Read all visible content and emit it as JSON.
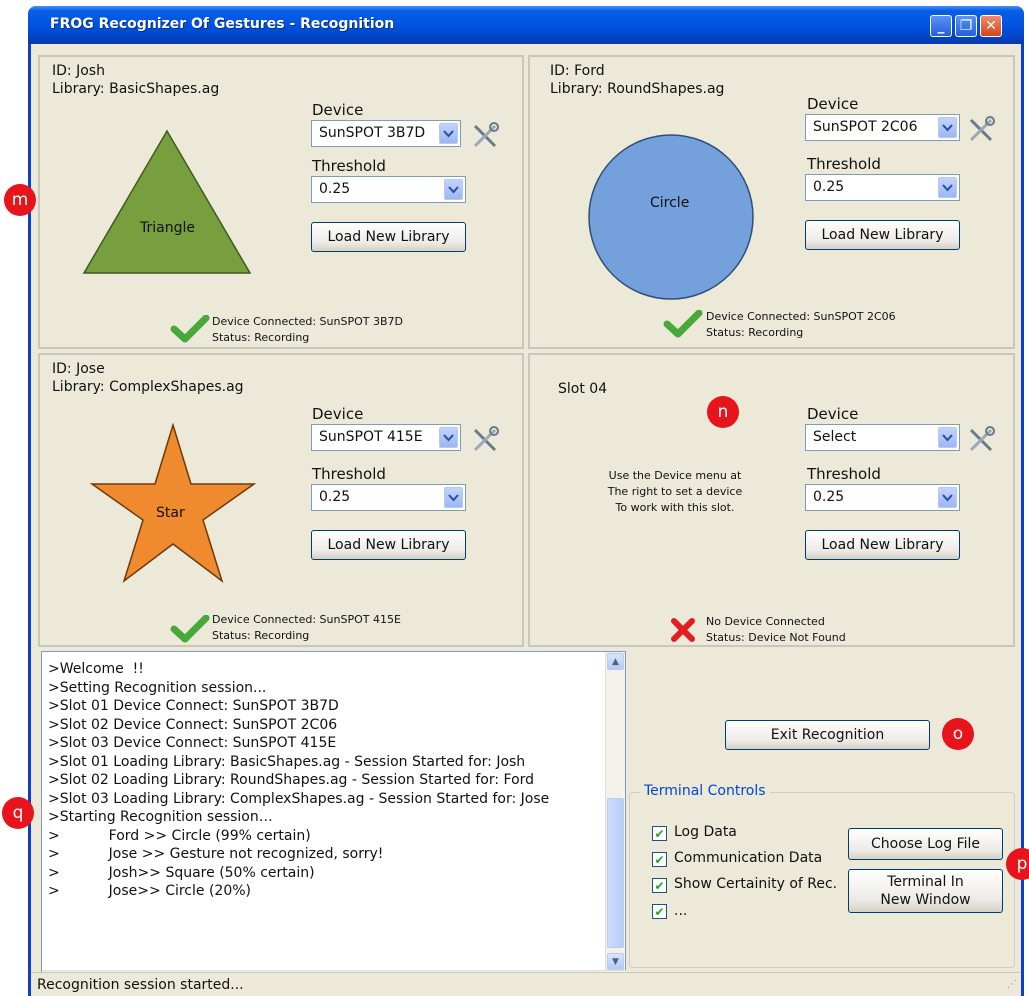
{
  "window": {
    "title": "FROG Recognizer Of Gestures - Recognition"
  },
  "labels": {
    "device": "Device",
    "threshold": "Threshold",
    "load_library": "Load New Library"
  },
  "slots": [
    {
      "id_line": "ID: Josh",
      "library_line": "Library: BasicShapes.ag",
      "shape": "Triangle",
      "shape_color": "#789F3E",
      "device": "SunSPOT 3B7D",
      "threshold": "0.25",
      "status_line1": "Device Connected: SunSPOT 3B7D",
      "status_line2": "Status: Recording",
      "status_icon": "check-icon"
    },
    {
      "id_line": "ID: Ford",
      "library_line": "Library: RoundShapes.ag",
      "shape": "Circle",
      "shape_color": "#74A0DB",
      "device": "SunSPOT 2C06",
      "threshold": "0.25",
      "status_line1": "Device Connected: SunSPOT 2C06",
      "status_line2": "Status: Recording",
      "status_icon": "check-icon"
    },
    {
      "id_line": "ID: Jose",
      "library_line": "Library: ComplexShapes.ag",
      "shape": "Star",
      "shape_color": "#F08A2E",
      "device": "SunSPOT 415E",
      "threshold": "0.25",
      "status_line1": "Device Connected: SunSPOT 415E",
      "status_line2": "Status: Recording",
      "status_icon": "check-icon"
    },
    {
      "title": "Slot 04",
      "message_line1": "Use the Device menu at",
      "message_line2": "The right to set a device",
      "message_line3": "To work with this slot.",
      "device": "Select",
      "threshold": "0.25",
      "status_line1": "No Device Connected",
      "status_line2": "Status: Device Not Found",
      "status_icon": "error-x-icon"
    }
  ],
  "markers": {
    "m": "m",
    "n": "n",
    "o": "o",
    "p": "p",
    "q": "q"
  },
  "terminal": {
    "lines": [
      ">Welcome  !!",
      ">Setting Recognition session...",
      ">Slot 01 Device Connect: SunSPOT 3B7D",
      ">Slot 02 Device Connect: SunSPOT 2C06",
      ">Slot 03 Device Connect: SunSPOT 415E",
      ">Slot 01 Loading Library: BasicShapes.ag - Session Started for: Josh",
      ">Slot 02 Loading Library: RoundShapes.ag - Session Started for: Ford",
      ">Slot 03 Loading Library: ComplexShapes.ag - Session Started for: Jose",
      ">Starting Recognition session…",
      ">           Ford >> Circle (99% certain)",
      ">           Jose >> Gesture not recognized, sorry!",
      ">           Josh>> Square (50% certain)",
      ">           Jose>> Circle (20%)"
    ]
  },
  "exit_button": "Exit Recognition",
  "terminal_controls": {
    "legend": "Terminal Controls",
    "options": [
      "Log Data",
      "Communication Data",
      "Show Certainity of Rec.",
      "..."
    ],
    "choose_log": "Choose Log File",
    "terminal_window_line1": "Terminal In",
    "terminal_window_line2": "New Window"
  },
  "statusbar": {
    "text": "Recognition session started..."
  }
}
